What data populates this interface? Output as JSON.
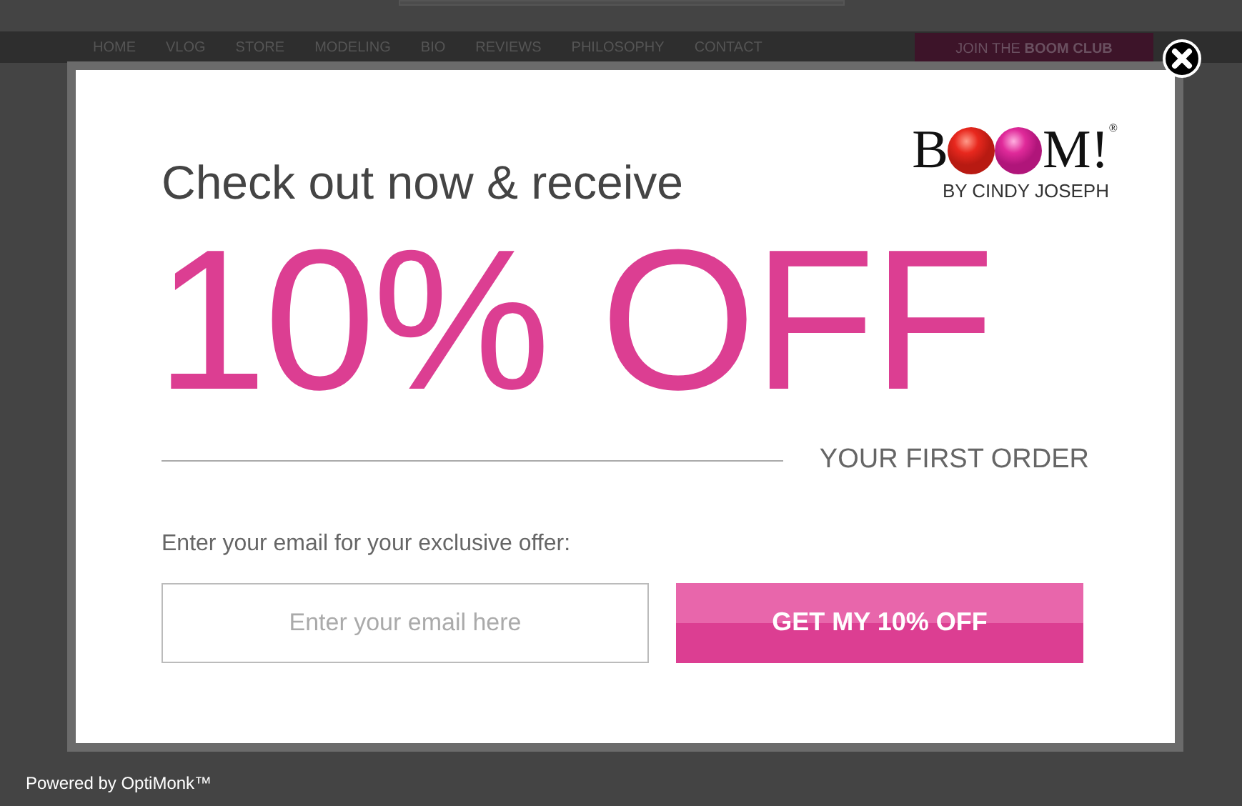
{
  "nav": {
    "items": [
      "HOME",
      "VLOG",
      "STORE",
      "MODELING",
      "BIO",
      "REVIEWS",
      "PHILOSOPHY",
      "CONTACT"
    ],
    "join_button": {
      "prefix": "JOIN THE",
      "bold": "BOOM CLUB"
    }
  },
  "popup": {
    "logo": {
      "first": "B",
      "last": "M!",
      "mark": "®",
      "tagline": "BY CINDY JOSEPH"
    },
    "headline": "Check out now & receive",
    "offer": "10% OFF",
    "subline": "YOUR FIRST ORDER",
    "prompt": "Enter your email for your exclusive offer:",
    "email_field": {
      "placeholder": "Enter your email here"
    },
    "submit_button": "GET MY 10% OFF"
  },
  "footer": {
    "powered_by": "Powered by OptiMonk™"
  }
}
